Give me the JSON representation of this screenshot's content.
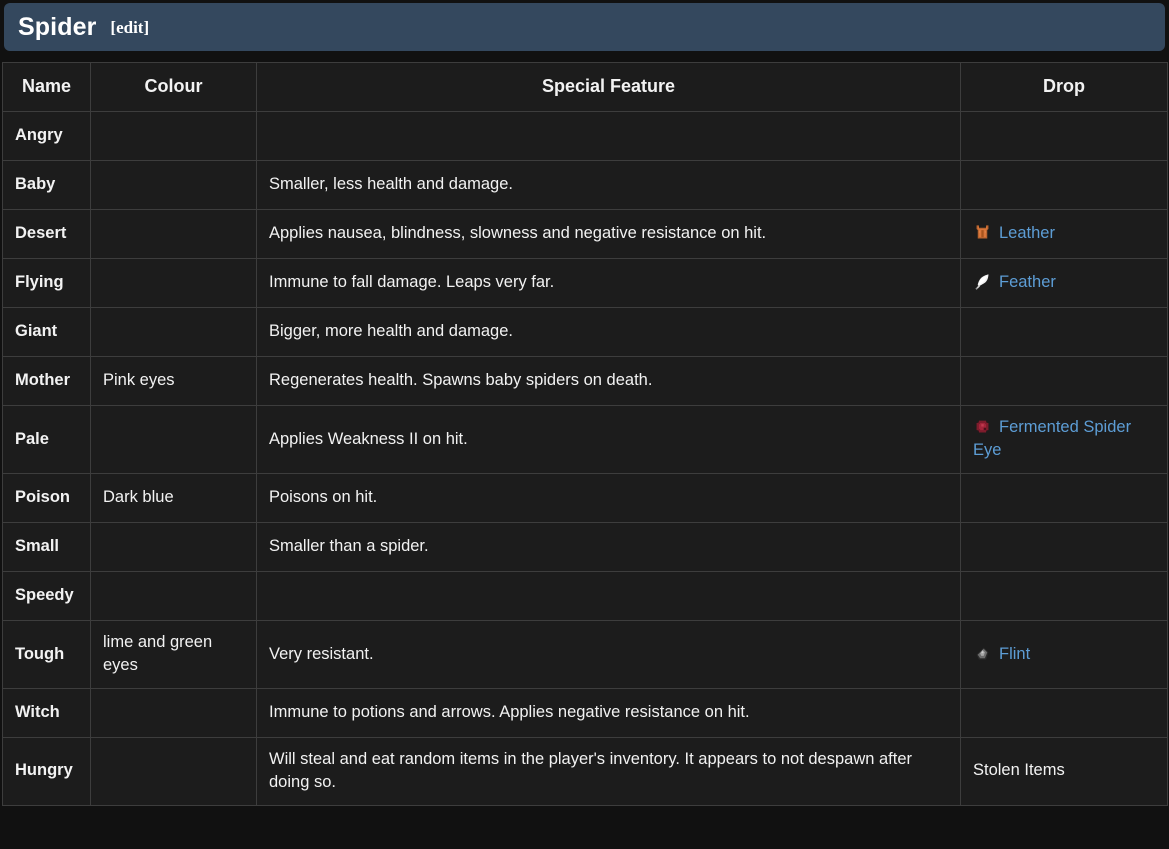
{
  "header": {
    "title": "Spider",
    "edit_label": "[edit]",
    "background_color": "#34485e"
  },
  "theme": {
    "page_background": "#111111",
    "cell_background": "#1c1c1c",
    "border_color": "#3d3d3d",
    "link_color": "#5d9dd5",
    "text_color": "#f2f2f2"
  },
  "table": {
    "columns": [
      {
        "key": "name",
        "label": "Name"
      },
      {
        "key": "colour",
        "label": "Colour"
      },
      {
        "key": "feature",
        "label": "Special Feature"
      },
      {
        "key": "drop",
        "label": "Drop"
      }
    ],
    "rows": [
      {
        "name": "Angry",
        "colour": "",
        "feature": "",
        "drop": {
          "text": "",
          "icon": "",
          "is_link": false
        }
      },
      {
        "name": "Baby",
        "colour": "",
        "feature": "Smaller, less health and damage.",
        "drop": {
          "text": "",
          "icon": "",
          "is_link": false
        }
      },
      {
        "name": "Desert",
        "colour": "",
        "feature": "Applies nausea, blindness, slowness and negative resistance on hit.",
        "drop": {
          "text": "Leather",
          "icon": "leather-icon",
          "is_link": true
        }
      },
      {
        "name": "Flying",
        "colour": "",
        "feature": "Immune to fall damage. Leaps very far.",
        "drop": {
          "text": "Feather",
          "icon": "feather-icon",
          "is_link": true
        }
      },
      {
        "name": "Giant",
        "colour": "",
        "feature": "Bigger, more health and damage.",
        "drop": {
          "text": "",
          "icon": "",
          "is_link": false
        }
      },
      {
        "name": "Mother",
        "colour": "Pink eyes",
        "feature": "Regenerates health. Spawns baby spiders on death.",
        "drop": {
          "text": "",
          "icon": "",
          "is_link": false
        }
      },
      {
        "name": "Pale",
        "colour": "",
        "feature": "Applies Weakness II on hit.",
        "drop": {
          "text": "Fermented Spider Eye",
          "icon": "fermented-spider-eye-icon",
          "is_link": true
        }
      },
      {
        "name": "Poison",
        "colour": "Dark blue",
        "feature": "Poisons on hit.",
        "drop": {
          "text": "",
          "icon": "",
          "is_link": false
        }
      },
      {
        "name": "Small",
        "colour": "",
        "feature": "Smaller than a spider.",
        "drop": {
          "text": "",
          "icon": "",
          "is_link": false
        }
      },
      {
        "name": "Speedy",
        "colour": "",
        "feature": "",
        "drop": {
          "text": "",
          "icon": "",
          "is_link": false
        }
      },
      {
        "name": "Tough",
        "colour": "lime and green eyes",
        "feature": "Very resistant.",
        "drop": {
          "text": "Flint",
          "icon": "flint-icon",
          "is_link": true
        }
      },
      {
        "name": "Witch",
        "colour": "",
        "feature": "Immune to potions and arrows. Applies negative resistance on hit.",
        "drop": {
          "text": "",
          "icon": "",
          "is_link": false
        }
      },
      {
        "name": "Hungry",
        "colour": "",
        "feature": "Will steal and eat random items in the player's inventory. It appears to not despawn after doing so.",
        "drop": {
          "text": "Stolen Items",
          "icon": "",
          "is_link": false
        }
      }
    ]
  }
}
